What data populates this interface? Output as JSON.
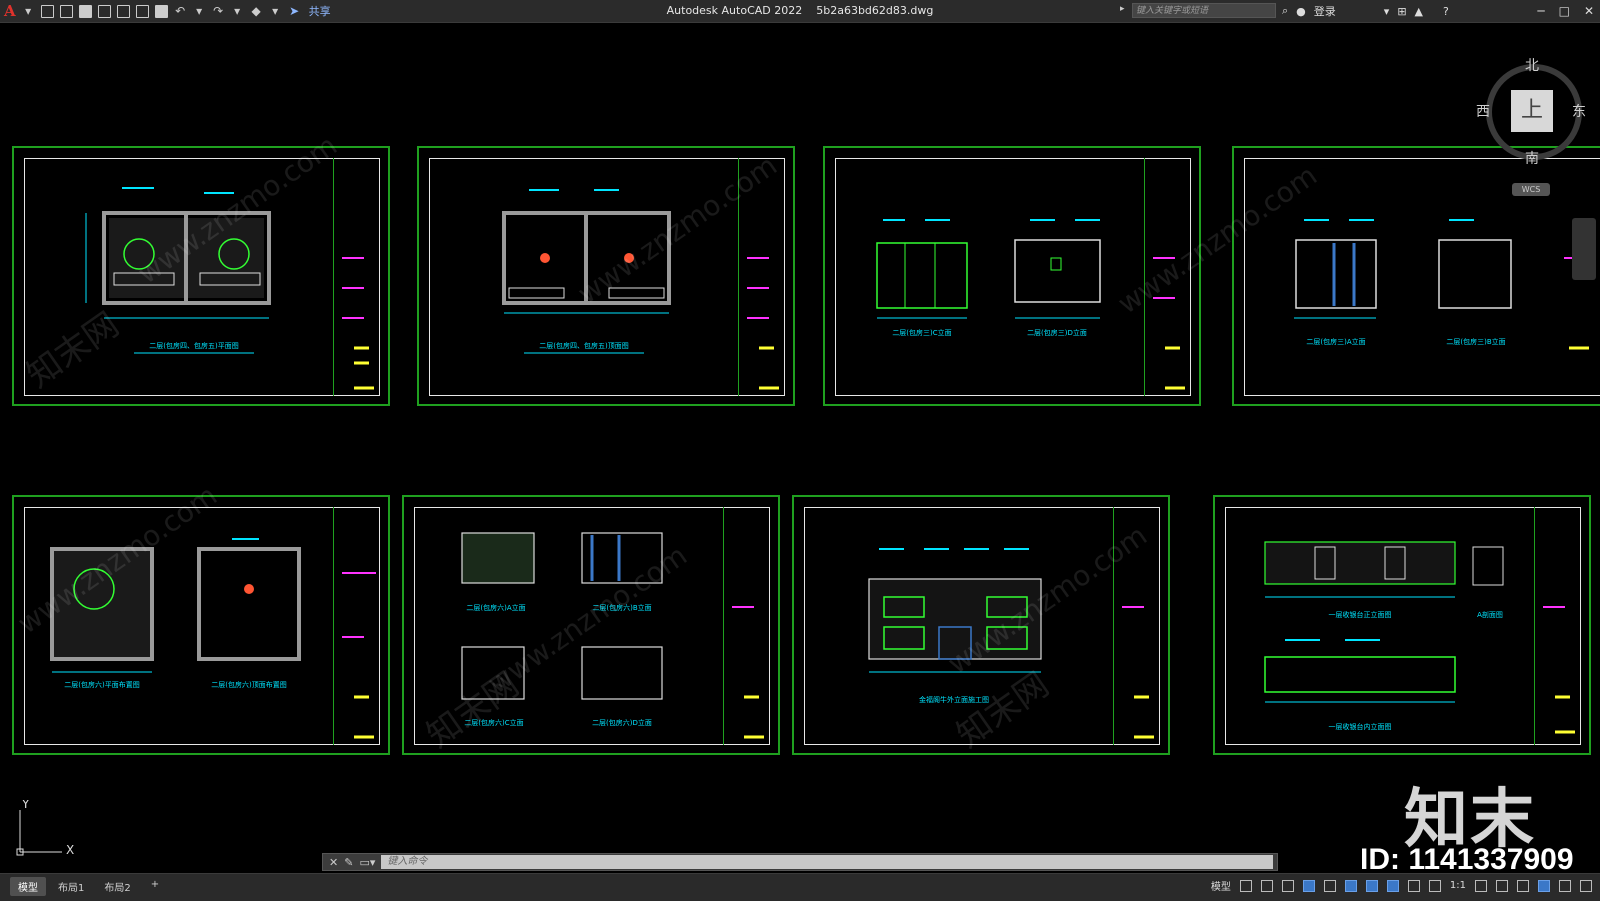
{
  "app": {
    "title": "Autodesk AutoCAD 2022",
    "filename": "5b2a63bd62d83.dwg",
    "share_label": "共享",
    "search_placeholder": "键入关键字或短语",
    "login_label": "登录"
  },
  "viewcube": {
    "north": "北",
    "south": "南",
    "east": "东",
    "west": "西",
    "face": "上",
    "wcs": "WCS"
  },
  "command": {
    "placeholder": "键入命令"
  },
  "layout_tabs": [
    "模型",
    "布局1",
    "布局2",
    "+"
  ],
  "status": {
    "model_label": "模型",
    "scale_label": "1:1"
  },
  "ucs": {
    "x": "X",
    "y": "Y"
  },
  "watermark": {
    "logo": "知末",
    "id_text": "ID: 1141337909",
    "site": "www.znzmo.com",
    "brand": "知末网"
  },
  "sheets": [
    {
      "caption": "二层(包房四、包房五)平面图",
      "scale": "1:40"
    },
    {
      "caption": "二层(包房四、包房五)顶面图",
      "scale": "1:40"
    },
    {
      "caption": "二层(包房三)C立面",
      "scale": "1:40",
      "caption2": "二层(包房三)D立面"
    },
    {
      "caption": "二层(包房三)A立面",
      "scale": "1:40",
      "caption2": "二层(包房三)B立面"
    },
    {
      "caption": "二层(包房六)平面布置图",
      "scale": "1:40",
      "caption2": "二层(包房六)顶面布置图"
    },
    {
      "caption": "二层(包房六)A立面",
      "scale": "1:50",
      "caption2": "二层(包房六)B立面",
      "caption3": "二层(包房六)C立面",
      "caption4": "二层(包房六)D立面"
    },
    {
      "caption": "金福阁牛外立面施工图",
      "scale": "1:100"
    },
    {
      "caption": "一层收银台正立面图",
      "scale": "1:20",
      "caption2": "A剖面图",
      "caption3": "一层收银台内立面图"
    }
  ],
  "colors": {
    "sheet_border": "#1fa01f",
    "dim_cyan": "#00e5ff",
    "text_magenta": "#ff33ff",
    "text_yellow": "#ffff33",
    "furniture_green": "#33ff33",
    "wall_gray": "#9a9a9a"
  }
}
